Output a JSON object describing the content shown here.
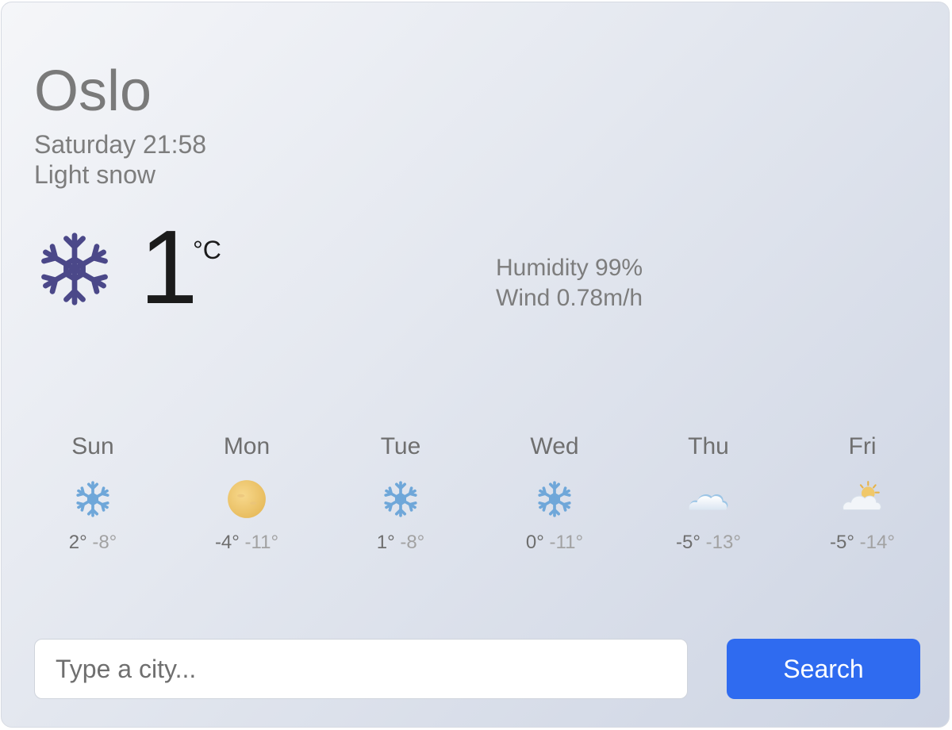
{
  "current": {
    "city": "Oslo",
    "datetime": "Saturday 21:58",
    "condition": "Light snow",
    "icon": "snowflake-icon",
    "temperature": "1",
    "unit": "°C",
    "humidity": "Humidity 99%",
    "wind": "Wind 0.78m/h"
  },
  "forecast": [
    {
      "day": "Sun",
      "icon": "snowflake-icon",
      "max": "2°",
      "min": "-8°"
    },
    {
      "day": "Mon",
      "icon": "sun-icon",
      "max": "-4°",
      "min": "-11°"
    },
    {
      "day": "Tue",
      "icon": "snowflake-icon",
      "max": "1°",
      "min": "-8°"
    },
    {
      "day": "Wed",
      "icon": "snowflake-icon",
      "max": "0°",
      "min": "-11°"
    },
    {
      "day": "Thu",
      "icon": "cloud-icon",
      "max": "-5°",
      "min": "-13°"
    },
    {
      "day": "Fri",
      "icon": "sun-behind-cloud-icon",
      "max": "-5°",
      "min": "-14°"
    }
  ],
  "search": {
    "placeholder": "Type a city...",
    "value": "",
    "button_label": "Search"
  },
  "colors": {
    "accent": "#2f6bf0",
    "snowflake_large": "#4b4889",
    "snowflake_small": "#6fa7d9",
    "sun": "#f0c86a",
    "cloud": "#e8eef6"
  }
}
